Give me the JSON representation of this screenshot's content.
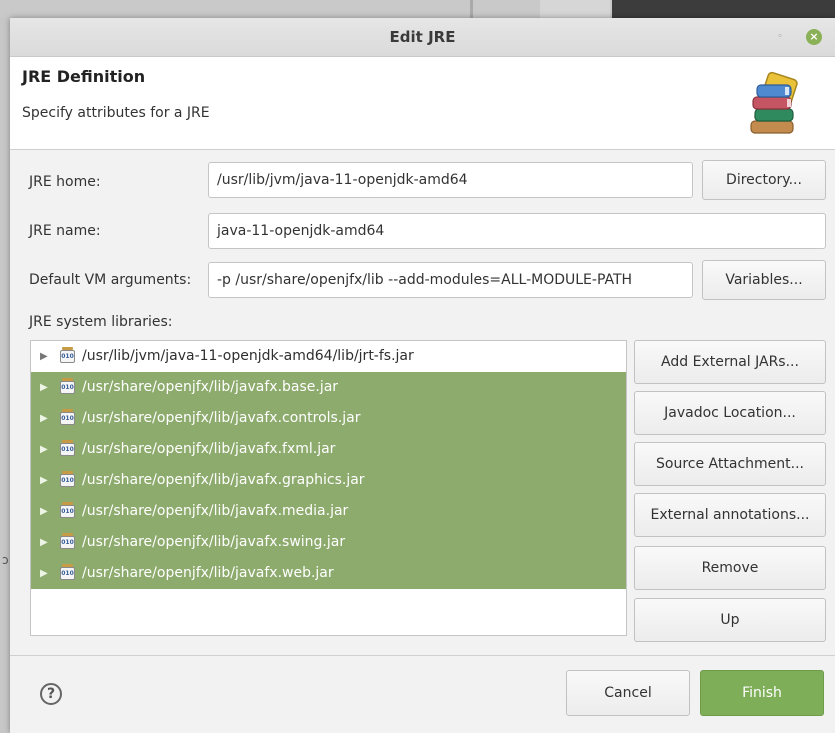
{
  "dialog": {
    "title": "Edit JRE"
  },
  "header": {
    "title": "JRE Definition",
    "subtitle": "Specify attributes for a JRE"
  },
  "form": {
    "jre_home": {
      "label": "JRE home:",
      "value": "/usr/lib/jvm/java-11-openjdk-amd64",
      "button": "Directory..."
    },
    "jre_name": {
      "label": "JRE name:",
      "value": "java-11-openjdk-amd64"
    },
    "vm_args": {
      "label": "Default VM arguments:",
      "value": "-p  /usr/share/openjfx/lib  --add-modules=ALL-MODULE-PATH",
      "button": "Variables..."
    }
  },
  "libraries": {
    "label": "JRE system libraries:",
    "items": [
      {
        "path": "/usr/lib/jvm/java-11-openjdk-amd64/lib/jrt-fs.jar",
        "selected": false
      },
      {
        "path": "/usr/share/openjfx/lib/javafx.base.jar",
        "selected": true
      },
      {
        "path": "/usr/share/openjfx/lib/javafx.controls.jar",
        "selected": true
      },
      {
        "path": "/usr/share/openjfx/lib/javafx.fxml.jar",
        "selected": true
      },
      {
        "path": "/usr/share/openjfx/lib/javafx.graphics.jar",
        "selected": true
      },
      {
        "path": "/usr/share/openjfx/lib/javafx.media.jar",
        "selected": true
      },
      {
        "path": "/usr/share/openjfx/lib/javafx.swing.jar",
        "selected": true
      },
      {
        "path": "/usr/share/openjfx/lib/javafx.web.jar",
        "selected": true
      }
    ],
    "buttons": {
      "add_external_jars": "Add External JARs...",
      "javadoc_location": "Javadoc Location...",
      "source_attachment": "Source Attachment...",
      "external_annotations": "External annotations...",
      "remove": "Remove",
      "up": "Up"
    }
  },
  "footer": {
    "help_glyph": "?",
    "cancel": "Cancel",
    "finish": "Finish"
  },
  "icons": {
    "close": "close-icon",
    "minimize": "minimize-icon",
    "header": "library-books-icon",
    "jar": "jar-file-icon",
    "expand": "chevron-right-icon",
    "help": "help-icon"
  },
  "colors": {
    "selection": "#8eab6e",
    "finish_button": "#7fae59",
    "close_button": "#8bb158"
  }
}
